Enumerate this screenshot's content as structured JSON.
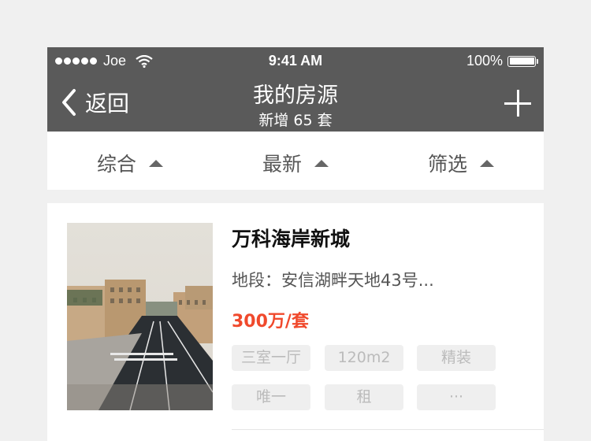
{
  "status_bar": {
    "carrier": "Joe",
    "time": "9:41 AM",
    "battery": "100%"
  },
  "nav": {
    "back_label": "返回",
    "title": "我的房源",
    "subtitle": "新增 65 套"
  },
  "sort_bar": [
    {
      "label": "综合"
    },
    {
      "label": "最新"
    },
    {
      "label": "筛选"
    }
  ],
  "listing": {
    "title": "万科海岸新城",
    "location": "地段：安信湖畔天地43号...",
    "price": "300万/套",
    "tags": [
      "三室一厅",
      "120m2",
      "精装",
      "唯一",
      "租",
      "···"
    ]
  },
  "colors": {
    "nav_bg": "#5a5a5a",
    "price": "#f0492c",
    "tag_bg": "#efefef",
    "tag_text": "#bbbbbb"
  },
  "icons": [
    "wifi-icon",
    "battery-icon",
    "back-chevron-icon",
    "add-icon",
    "sort-arrow-icon"
  ]
}
